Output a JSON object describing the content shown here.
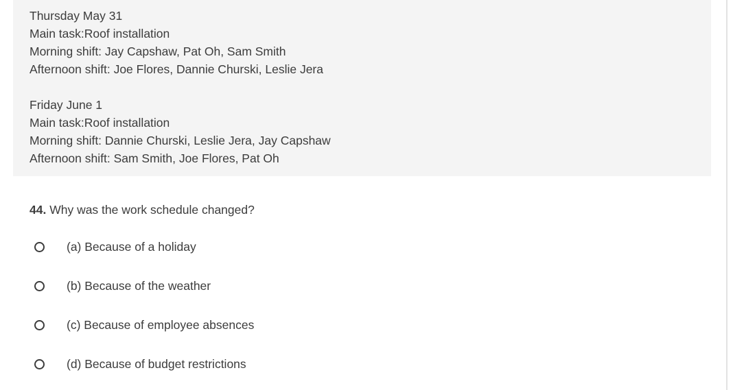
{
  "schedule": {
    "days": [
      {
        "date": "Thursday May 31",
        "main_task": "Main task:Roof installation",
        "morning": "Morning shift: Jay Capshaw, Pat Oh, Sam Smith",
        "afternoon": "Afternoon shift: Joe Flores, Dannie Churski, Leslie Jera"
      },
      {
        "date": "Friday June 1",
        "main_task": "Main task:Roof installation",
        "morning": "Morning shift: Dannie Churski, Leslie Jera, Jay Capshaw",
        "afternoon": "Afternoon shift: Sam Smith, Joe Flores, Pat Oh"
      }
    ]
  },
  "question": {
    "number": "44.",
    "text": "Why was the work schedule changed?",
    "options": [
      {
        "label": "(a) Because of a holiday",
        "selected": false
      },
      {
        "label": "(b) Because of the weather",
        "selected": false
      },
      {
        "label": "(c) Because of employee absences",
        "selected": false
      },
      {
        "label": "(d) Because of budget restrictions",
        "selected": false
      }
    ]
  }
}
